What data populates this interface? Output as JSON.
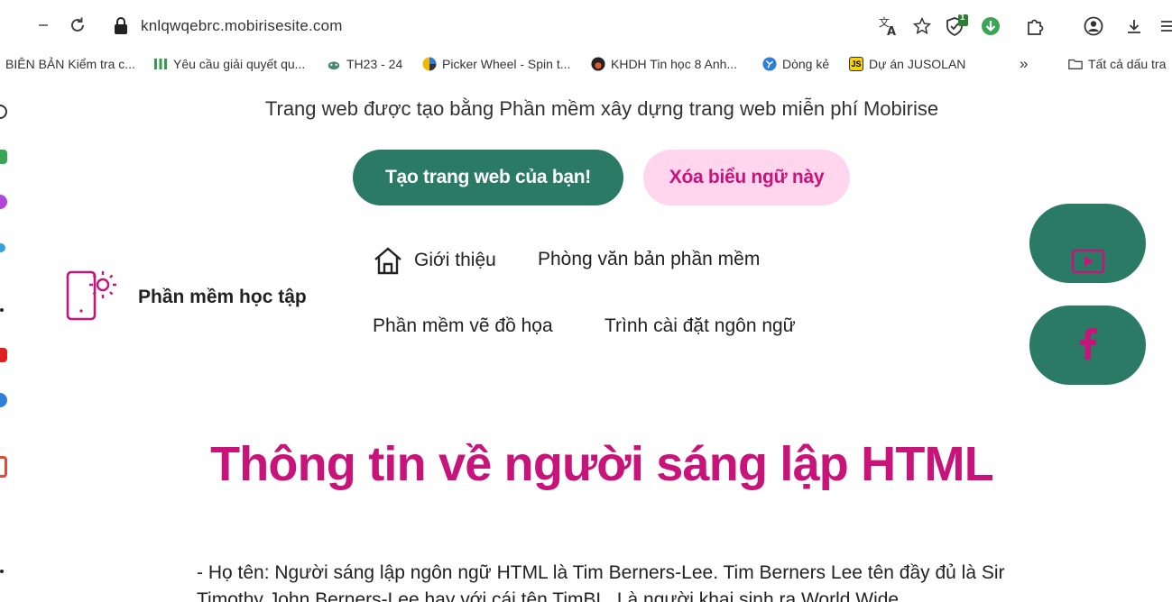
{
  "browser": {
    "url": "knlqwqebrc.mobirisesite.com",
    "extension_badge": "1",
    "bookmarks": [
      "BIÊN BẢN Kiểm tra c...",
      "Yêu cầu giải quyết qu...",
      "TH23 - 24",
      "Picker Wheel - Spin t...",
      "KHDH Tin học 8 Anh...",
      "Dòng kẻ",
      "Dự án JUSOLAN",
      "Tất cả dấu tra"
    ],
    "overflow_label": "»",
    "js_badge": "JS"
  },
  "banner": {
    "text": "Trang web được tạo bằng Phần mềm xây dựng trang web miễn phí Mobirise",
    "create_button": "Tạo trang web của bạn!",
    "remove_button": "Xóa biểu ngữ này"
  },
  "header": {
    "brand": "Phần mềm học tập",
    "menu": [
      "Giới thiệu",
      "Phòng văn bản phần mềm",
      "Phần mềm vẽ đồ họa",
      "Trình cài đặt ngôn ngữ"
    ]
  },
  "content": {
    "heading": "Thông tin về người sáng lập HTML",
    "paragraph": "- Họ tên: Người sáng lập ngôn ngữ HTML là Tim Berners-Lee. Tim Berners Lee tên đầy đủ là Sir Timothy John Berners-Lee hay với cái tên TimBL. Là người khai sinh ra World Wide"
  },
  "colors": {
    "accent_green": "#2a7a66",
    "accent_pink": "#c8147a",
    "pink_light": "#ffd6ee"
  },
  "icons": [
    "back-icon",
    "forward-icon",
    "reload-icon",
    "lock-icon",
    "translate-icon",
    "star-icon",
    "extension-shield-icon",
    "download-arrow-icon",
    "puzzle-icon",
    "profile-icon",
    "download-icon",
    "menu-icon",
    "home-icon",
    "phone-sun-logo-icon",
    "youtube-icon",
    "facebook-icon"
  ]
}
